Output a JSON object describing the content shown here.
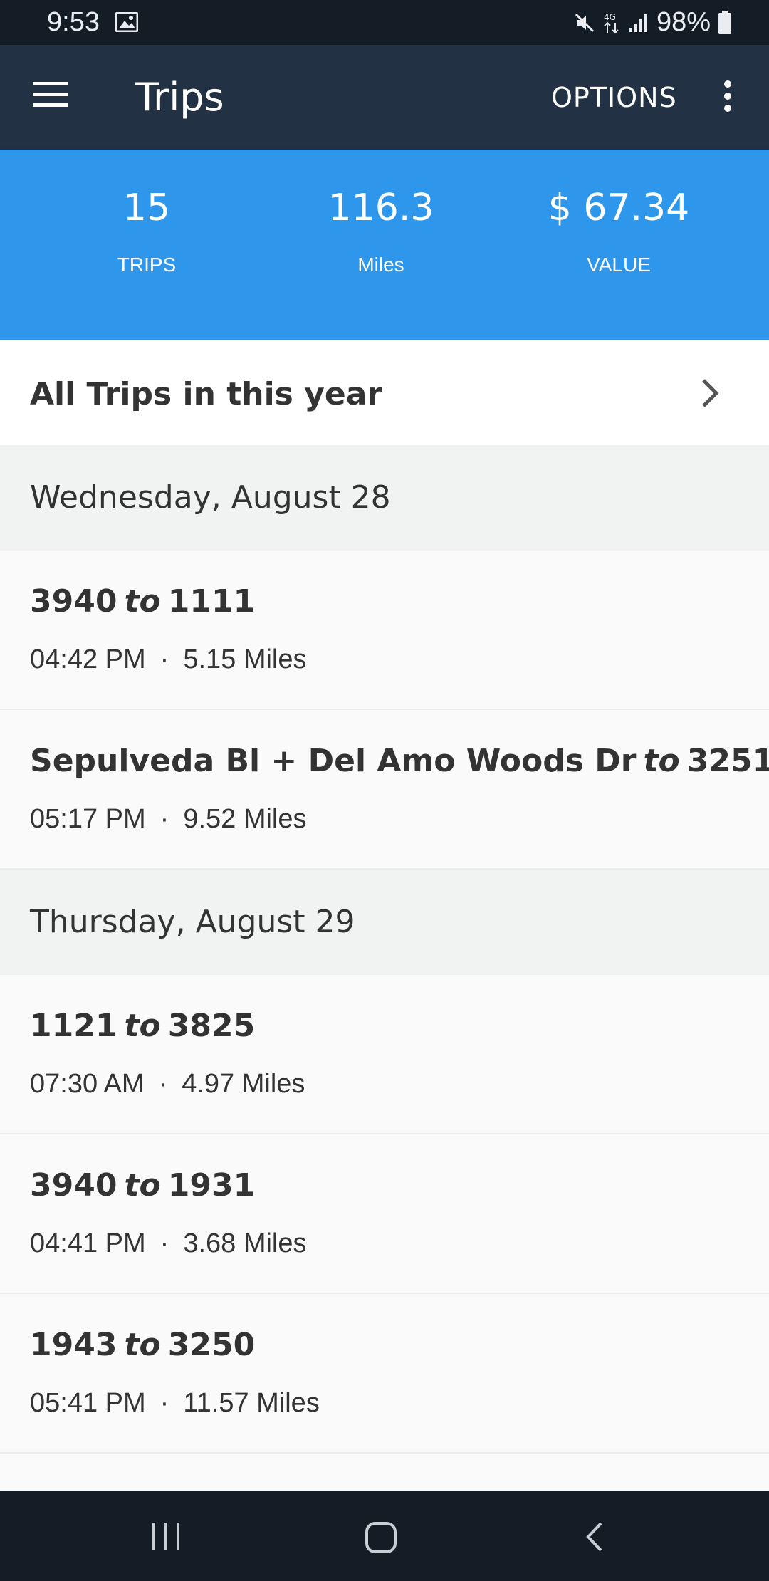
{
  "status_bar": {
    "time": "9:53",
    "battery": "98%"
  },
  "app_bar": {
    "title": "Trips",
    "options_label": "OPTIONS"
  },
  "summary": {
    "trips_value": "15",
    "trips_label": "TRIPS",
    "miles_value": "116.3",
    "miles_label": "Miles",
    "value_value": "$ 67.34",
    "value_label": "VALUE"
  },
  "filter": {
    "label": "All Trips in this year"
  },
  "days": [
    {
      "header": "Wednesday, August 28",
      "trips": [
        {
          "from": "3940",
          "to_word": "to",
          "to": "1111",
          "time": "04:42 PM",
          "sep": "·",
          "distance": "5.15 Miles"
        },
        {
          "from": "Sepulveda Bl + Del Amo Woods Dr",
          "to_word": "to",
          "to": "3251",
          "time": "05:17 PM",
          "sep": "·",
          "distance": "9.52 Miles"
        }
      ]
    },
    {
      "header": "Thursday, August 29",
      "trips": [
        {
          "from": "1121",
          "to_word": "to",
          "to": "3825",
          "time": "07:30 AM",
          "sep": "·",
          "distance": "4.97 Miles"
        },
        {
          "from": "3940",
          "to_word": "to",
          "to": "1931",
          "time": "04:41 PM",
          "sep": "·",
          "distance": "3.68 Miles"
        },
        {
          "from": "1943",
          "to_word": "to",
          "to": "3250",
          "time": "05:41 PM",
          "sep": "·",
          "distance": "11.57 Miles"
        }
      ]
    }
  ],
  "icons": {
    "menu": "hamburger-menu-icon",
    "more": "more-vertical-icon",
    "chevron": "chevron-right-icon",
    "nav_recents": "recents-icon",
    "nav_home": "home-icon",
    "nav_back": "back-icon"
  },
  "colors": {
    "status_bar": "#141c26",
    "app_bar": "#223244",
    "summary": "#2e97eb",
    "day_header": "#f1f3f3"
  }
}
